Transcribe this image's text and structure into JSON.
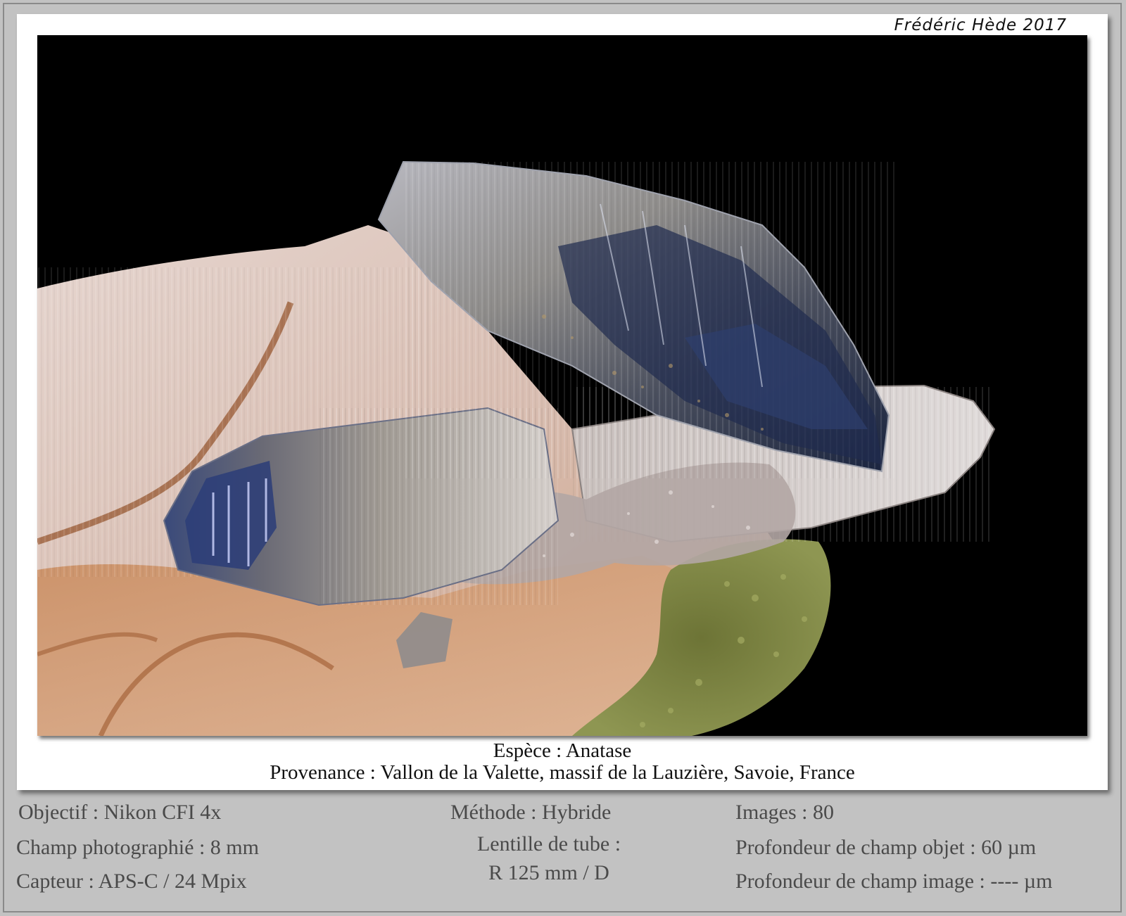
{
  "signature": "Frédéric Hède 2017",
  "caption": {
    "species": "Espèce : Anatase",
    "provenance": "Provenance : Vallon de la Valette, massif de la Lauzière, Savoie, France"
  },
  "specs": {
    "objective": "Objectif  : Nikon CFI 4x",
    "field": "Champ photographié : 8 mm",
    "sensor": "Capteur : APS-C / 24 Mpix",
    "method": "Méthode : Hybride",
    "tube_lens_label": "Lentille de tube :",
    "tube_lens_value": "R 125 mm / D",
    "images": "Images : 80",
    "dof_object": "Profondeur de champ objet : 60 µm",
    "dof_image": "Profondeur de champ image : ---- µm"
  },
  "colors": {
    "background": "#c2c2c2",
    "card": "#ffffff",
    "photo_background": "#000000",
    "spec_text": "#4a4a4a"
  }
}
